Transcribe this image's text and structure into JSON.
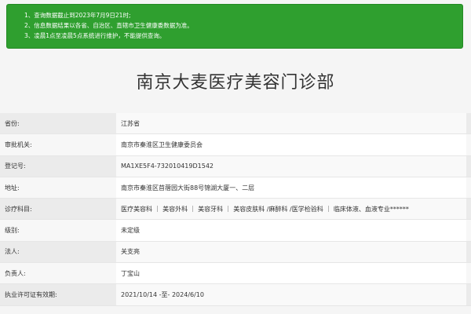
{
  "notice": {
    "lines": [
      "1、查询数据截止到2023年7月9日21时;",
      "2、信息数据结果以各省、自治区、直辖市卫生健康委数据为准。",
      "3、凌晨1点至凌晨5点系统进行维护，不能提供查询。"
    ],
    "background": "#2f9f2f"
  },
  "title": "南京大麦医疗美容门诊部",
  "fields": [
    {
      "label": "省份:",
      "value": "江苏省"
    },
    {
      "label": "审批机关:",
      "value": "南京市秦淮区卫生健康委员会"
    },
    {
      "label": "登记号:",
      "value": "MA1XE5F4-732010419D1542"
    },
    {
      "label": "地址:",
      "value": "南京市秦淮区苜蓿园大街88号锦湖大厦一、二层"
    },
    {
      "label": "诊疗科目:",
      "value": "医疗美容科 ｜ 美容外科 ｜ 美容牙科 ｜ 美容皮肤科 /麻醉科 /医学检验科 ｜ 临床体液、血液专业******"
    },
    {
      "label": "级别:",
      "value": "未定级"
    },
    {
      "label": "法人:",
      "value": "关支亮"
    },
    {
      "label": "负责人:",
      "value": "丁宝山"
    },
    {
      "label": "执业许可证有效期:",
      "value": "2021/10/14 -至- 2024/6/10"
    }
  ]
}
